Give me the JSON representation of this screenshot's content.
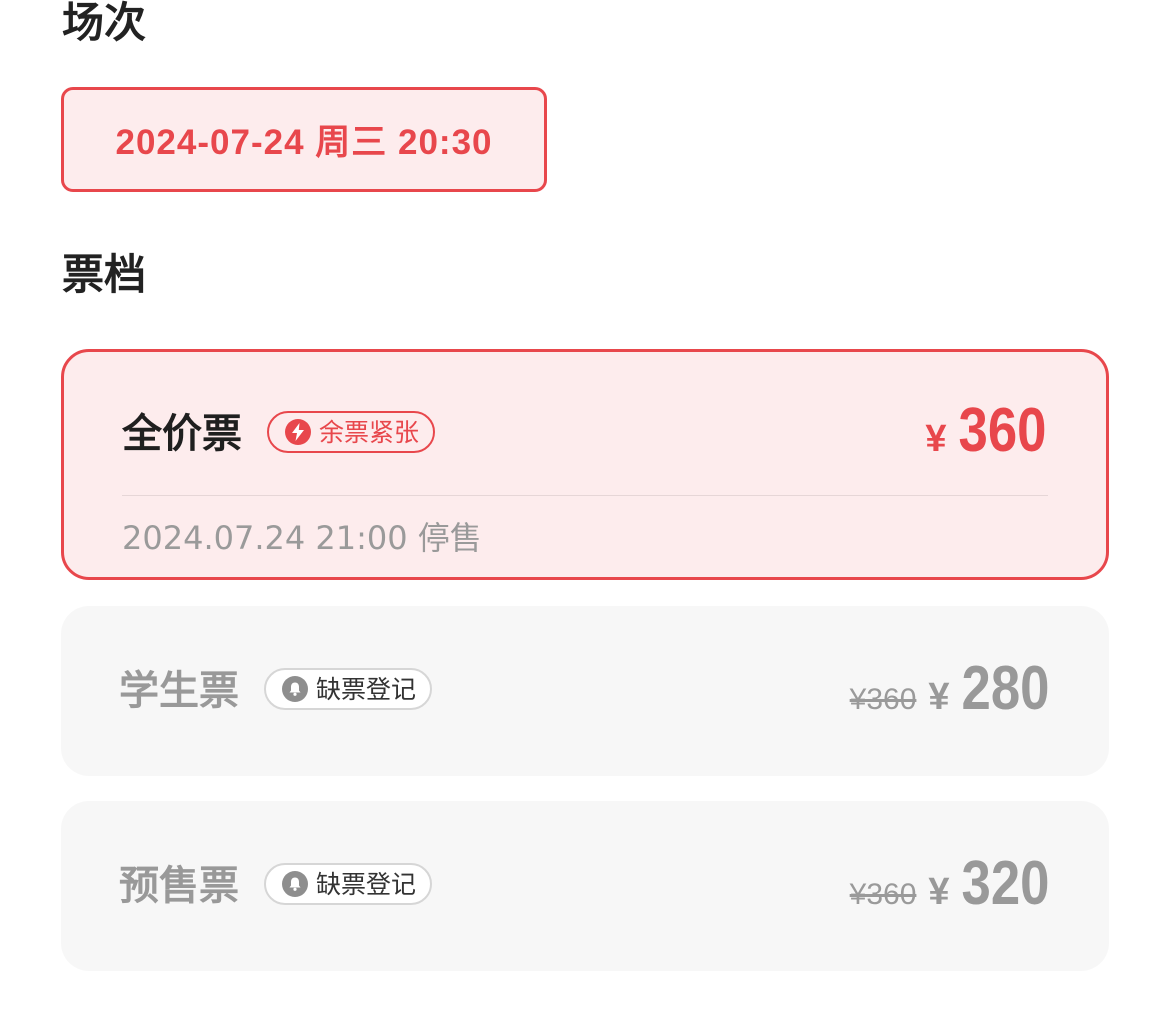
{
  "sections": {
    "session_title": "场次",
    "tier_title": "票档"
  },
  "session": {
    "label": "2024-07-24 周三 20:30",
    "selected": true
  },
  "tickets": [
    {
      "name": "全价票",
      "badge": "余票紧张",
      "badge_icon": "lightning-icon",
      "price_symbol": "¥",
      "price": "360",
      "original_price": "",
      "stop_sale": "2024.07.24 21:00 停售",
      "selected": true
    },
    {
      "name": "学生票",
      "badge": "缺票登记",
      "badge_icon": "bell-icon",
      "price_symbol": "¥",
      "price": "280",
      "original_price": "¥360",
      "selected": false
    },
    {
      "name": "预售票",
      "badge": "缺票登记",
      "badge_icon": "bell-icon",
      "price_symbol": "¥",
      "price": "320",
      "original_price": "¥360",
      "selected": false
    }
  ],
  "colors": {
    "accent": "#e8474c",
    "accent_bg": "#fdeced",
    "disabled_bg": "#f7f7f7",
    "muted_text": "#999999"
  }
}
